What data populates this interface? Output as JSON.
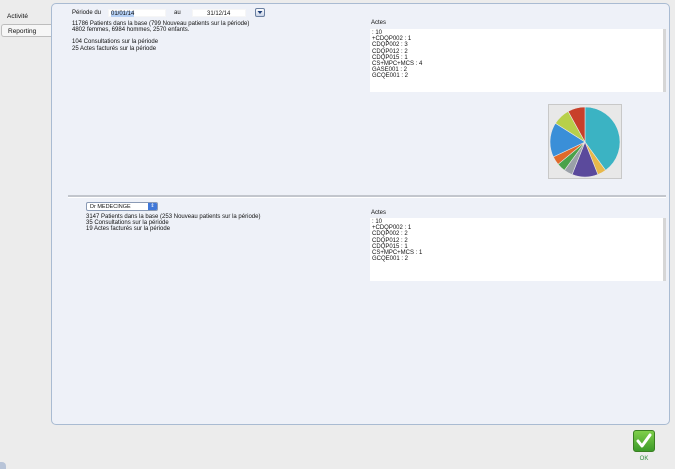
{
  "tabs": [
    {
      "label": "Activité"
    },
    {
      "label": "Reporting"
    }
  ],
  "period": {
    "label_from": "Période du",
    "from_value": "01/01/14",
    "label_to": "au",
    "to_value": "31/12/14"
  },
  "global_stats": {
    "patients_line": "11786 Patients dans la base (799 Nouveau patients sur la période)",
    "gender_line": "4802 femmes, 6984 hommes, 2570 enfants.",
    "consultations_line": "104 Consultations sur la période",
    "actes_line": "25 Actes facturés sur la période"
  },
  "global_actes": {
    "title": "Actes",
    "items": [
      " : 10",
      "+CDQP002 : 1",
      "CDQP002 : 3",
      "CDQP012 : 2",
      "CDQP015 : 1",
      "CS+MPC+MCS : 4",
      "GASE001 : 2",
      "GCQE001 : 2"
    ]
  },
  "chart_data": {
    "type": "pie",
    "slices": [
      {
        "label": "",
        "value": 10,
        "color": "#3bb3c3"
      },
      {
        "label": "",
        "value": 1,
        "color": "#e8b84a"
      },
      {
        "label": "",
        "value": 3,
        "color": "#5b4a9c"
      },
      {
        "label": "",
        "value": 1,
        "color": "#9aa0a8"
      },
      {
        "label": "",
        "value": 1,
        "color": "#4aa24a"
      },
      {
        "label": "",
        "value": 1,
        "color": "#e06a2a"
      },
      {
        "label": "",
        "value": 4,
        "color": "#3a8fd8"
      },
      {
        "label": "",
        "value": 2,
        "color": "#b8d04a"
      },
      {
        "label": "",
        "value": 2,
        "color": "#c8402a"
      }
    ]
  },
  "doctor": {
    "select_value": "Dr MEDECINGE",
    "patients_line": "3147 Patients dans la base (253 Nouveau patients sur la période)",
    "consultations_line": "35 Consultations sur la période",
    "actes_line": "19 Actes facturés sur la période"
  },
  "doctor_actes": {
    "title": "Actes",
    "items": [
      " : 10",
      "+CDQP002 : 1",
      "CDQP002 : 2",
      "CDQP012 : 2",
      "CDQP015 : 1",
      "CS+MPC+MCS : 1",
      "GCQE001 : 2"
    ]
  },
  "ok": {
    "label": "OK"
  }
}
